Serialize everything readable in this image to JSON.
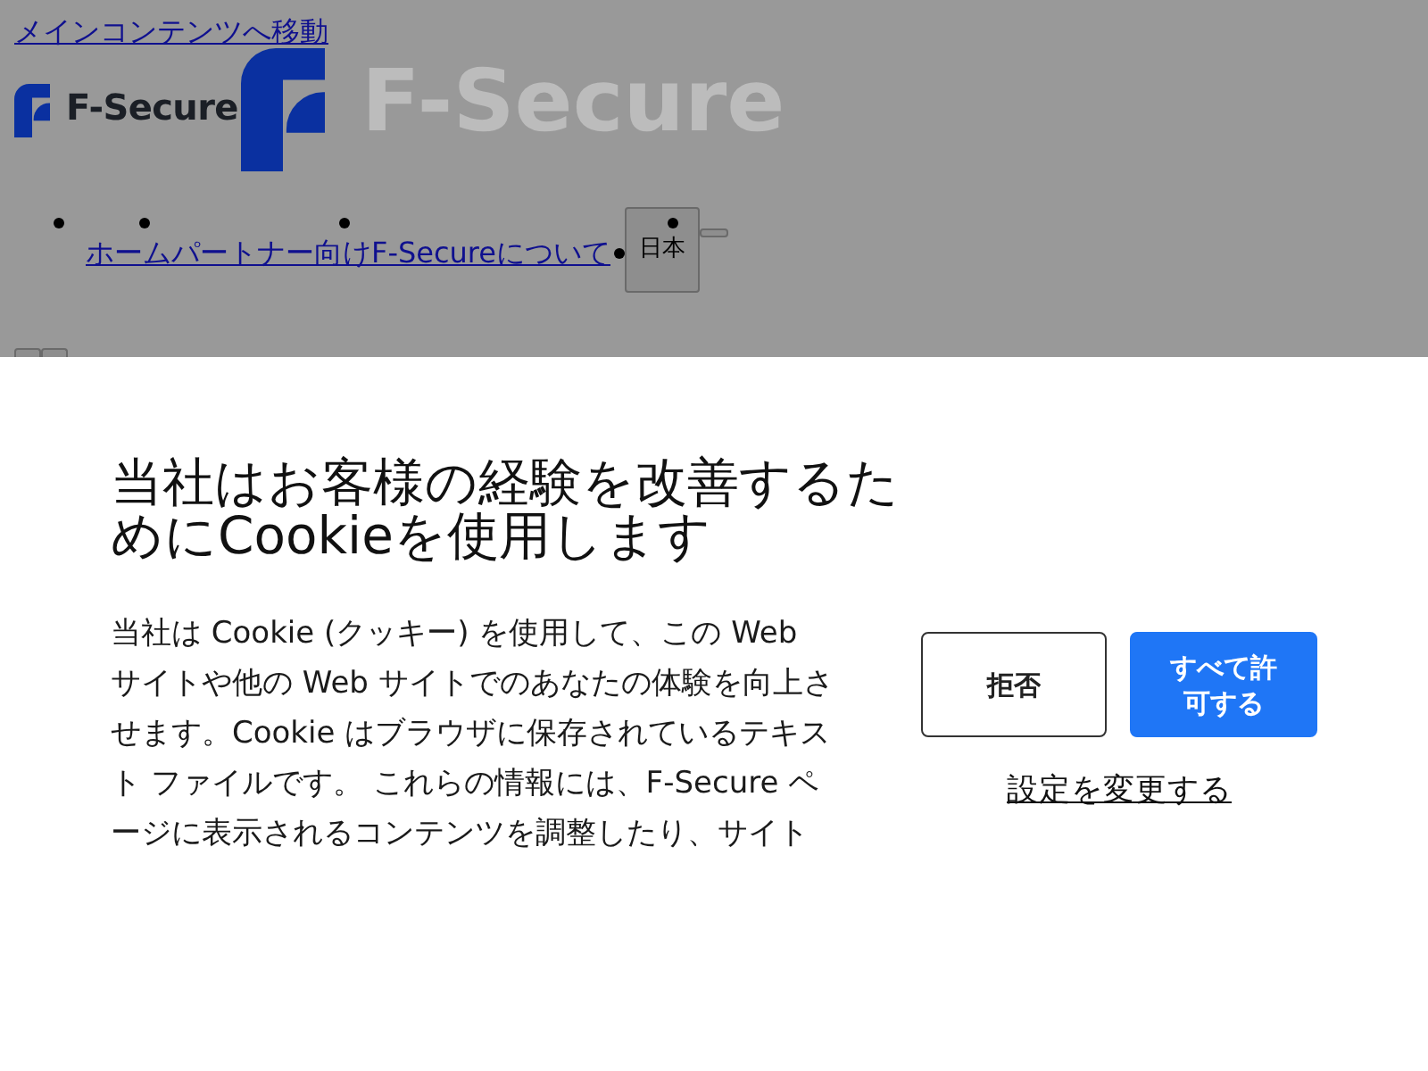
{
  "page": {
    "dimmed": true,
    "skip_link": "メインコンテンツへ移動",
    "logo": {
      "wordmark": "F-Secure",
      "large_text": "F-Secure"
    },
    "nav": {
      "items": [
        {
          "label": "ホーム"
        },
        {
          "label": "パートナー向け"
        },
        {
          "label": "F-Secureについて"
        }
      ],
      "language_button": "日本"
    }
  },
  "cookie_banner": {
    "title": "当社はお客様の経験を改善するためにCookieを使用します",
    "description": "当社は Cookie (クッキー) を使用して、この Web サイトや他の Web サイトでのあなたの体験を向上させます。Cookie はブラウザに保存されているテキスト ファイルです。 これらの情報には、F-Secure ページに表示されるコンテンツを調整したり、サイト",
    "buttons": [
      {
        "label": "拒否",
        "kind": "secondary"
      },
      {
        "label": "すべて許可する",
        "kind": "primary"
      }
    ],
    "settings_link": "設定を変更する"
  }
}
